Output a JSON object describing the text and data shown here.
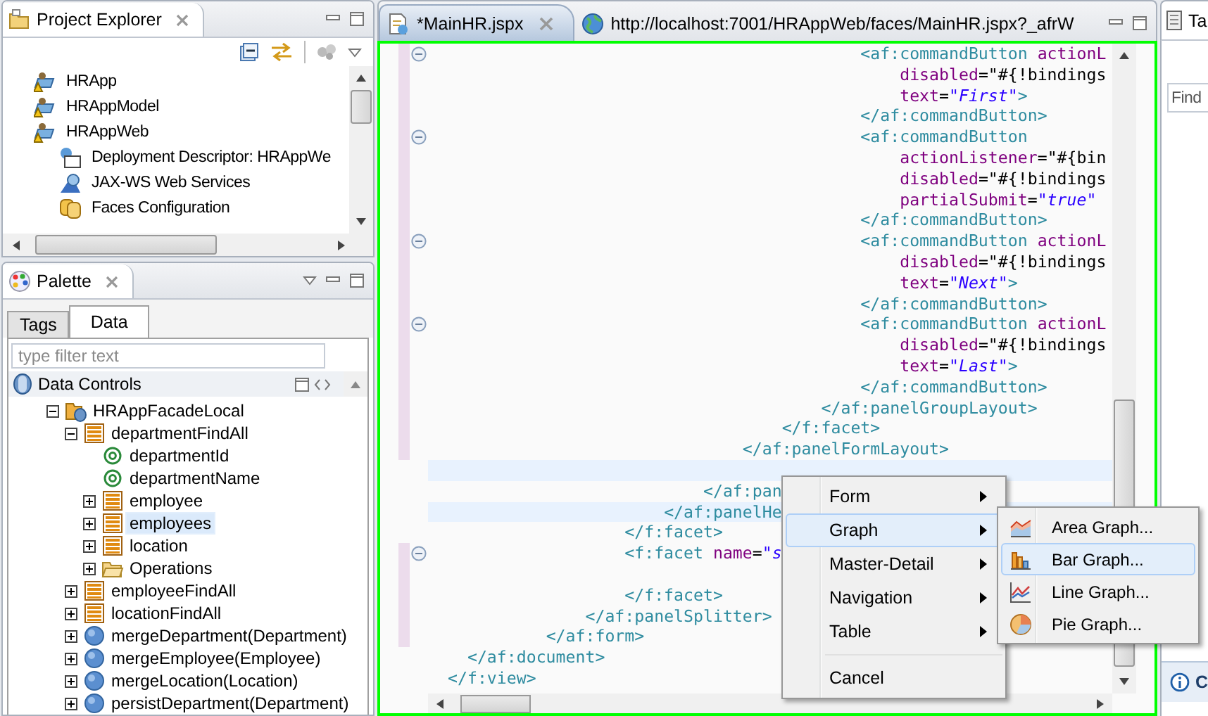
{
  "project_explorer": {
    "title": "Project Explorer",
    "items": [
      {
        "label": "HRApp",
        "kind": "project",
        "selected": false
      },
      {
        "label": "HRAppModel",
        "kind": "project",
        "selected": false
      },
      {
        "label": "HRAppWeb",
        "kind": "project",
        "selected": false,
        "children": [
          {
            "label": "Deployment Descriptor: HRAppWe",
            "kind": "descriptor",
            "selected": false
          },
          {
            "label": "JAX-WS Web Services",
            "kind": "webservices",
            "selected": false
          },
          {
            "label": "Faces Configuration",
            "kind": "faces",
            "selected": false
          }
        ]
      }
    ]
  },
  "palette": {
    "title": "Palette",
    "tabs": [
      {
        "label": "Tags",
        "selected": false
      },
      {
        "label": "Data",
        "selected": true
      }
    ],
    "filter": {
      "placeholder": "type filter text"
    },
    "section": "Data Controls",
    "items": [
      {
        "label": "HRAppFacadeLocal",
        "kind": "datacontrol",
        "expanded": true,
        "selected": false,
        "children": [
          {
            "label": "departmentFindAll",
            "kind": "collection",
            "expanded": true,
            "selected": false,
            "children": [
              {
                "label": "departmentId",
                "kind": "attribute",
                "selected": false
              },
              {
                "label": "departmentName",
                "kind": "attribute",
                "selected": false
              },
              {
                "label": "employee",
                "kind": "collection",
                "expanded": false,
                "selected": false
              },
              {
                "label": "employees",
                "kind": "collection",
                "expanded": false,
                "selected": true
              },
              {
                "label": "location",
                "kind": "collection",
                "expanded": false,
                "selected": false
              },
              {
                "label": "Operations",
                "kind": "folder",
                "expanded": false,
                "selected": false
              }
            ]
          },
          {
            "label": "employeeFindAll",
            "kind": "collection",
            "expanded": false,
            "selected": false
          },
          {
            "label": "locationFindAll",
            "kind": "collection",
            "expanded": false,
            "selected": false
          },
          {
            "label": "mergeDepartment(Department)",
            "kind": "method",
            "expanded": false,
            "selected": false
          },
          {
            "label": "mergeEmployee(Employee)",
            "kind": "method",
            "expanded": false,
            "selected": false
          },
          {
            "label": "mergeLocation(Location)",
            "kind": "method",
            "expanded": false,
            "selected": false
          },
          {
            "label": "persistDepartment(Department)",
            "kind": "method",
            "expanded": false,
            "selected": false
          }
        ]
      }
    ]
  },
  "editor": {
    "tabs": [
      {
        "label": "*MainHR.jspx",
        "kind": "source",
        "selected": true
      },
      {
        "label": "http://localhost:7001/HRAppWeb/faces/MainHR.jspx?_afrW",
        "kind": "browser",
        "selected": false
      }
    ],
    "lines": [
      {
        "text": "                                          <af:commandButton actionL",
        "fold": true,
        "changed": true,
        "highlighted": false
      },
      {
        "text": "                                              disabled=\"#{!bindings",
        "fold": false,
        "changed": true,
        "highlighted": false
      },
      {
        "text": "                                              text=\"First\">",
        "fold": false,
        "changed": true,
        "highlighted": false
      },
      {
        "text": "                                          </af:commandButton>",
        "fold": false,
        "changed": true,
        "highlighted": false
      },
      {
        "text": "                                          <af:commandButton",
        "fold": true,
        "changed": true,
        "highlighted": false
      },
      {
        "text": "                                              actionListener=\"#{bin",
        "fold": false,
        "changed": true,
        "highlighted": false
      },
      {
        "text": "                                              disabled=\"#{!bindings",
        "fold": false,
        "changed": true,
        "highlighted": false
      },
      {
        "text": "                                              partialSubmit=\"true\"",
        "fold": false,
        "changed": true,
        "highlighted": false
      },
      {
        "text": "                                          </af:commandButton>",
        "fold": false,
        "changed": true,
        "highlighted": false
      },
      {
        "text": "                                          <af:commandButton actionL",
        "fold": true,
        "changed": true,
        "highlighted": false
      },
      {
        "text": "                                              disabled=\"#{!bindings",
        "fold": false,
        "changed": true,
        "highlighted": false
      },
      {
        "text": "                                              text=\"Next\">",
        "fold": false,
        "changed": true,
        "highlighted": false
      },
      {
        "text": "                                          </af:commandButton>",
        "fold": false,
        "changed": true,
        "highlighted": false
      },
      {
        "text": "                                          <af:commandButton actionL",
        "fold": true,
        "changed": true,
        "highlighted": false
      },
      {
        "text": "                                              disabled=\"#{!bindings",
        "fold": false,
        "changed": true,
        "highlighted": false
      },
      {
        "text": "                                              text=\"Last\">",
        "fold": false,
        "changed": true,
        "highlighted": false
      },
      {
        "text": "                                          </af:commandButton>",
        "fold": false,
        "changed": true,
        "highlighted": false
      },
      {
        "text": "                                      </af:panelGroupLayout>",
        "fold": false,
        "changed": true,
        "highlighted": false
      },
      {
        "text": "                                  </f:facet>",
        "fold": false,
        "changed": true,
        "highlighted": false
      },
      {
        "text": "                              </af:panelFormLayout>",
        "fold": false,
        "changed": true,
        "highlighted": false
      },
      {
        "fold": false,
        "changed": false,
        "highlighted": true
      },
      {
        "text": "                          </af:pan",
        "fold": false,
        "changed": false,
        "highlighted": false
      },
      {
        "text": "                      </af:panelHe",
        "fold": false,
        "changed": false,
        "highlighted": true
      },
      {
        "text": "                  </f:facet>",
        "fold": false,
        "changed": false,
        "highlighted": false
      },
      {
        "text": "                  <f:facet name=\"s",
        "fold": true,
        "changed": true,
        "highlighted": false
      },
      {
        "fold": false,
        "changed": true,
        "highlighted": false
      },
      {
        "text": "                  </f:facet>",
        "fold": false,
        "changed": true,
        "highlighted": false
      },
      {
        "text": "              </af:panelSplitter>",
        "fold": false,
        "changed": true,
        "highlighted": false
      },
      {
        "text": "          </af:form>",
        "fold": false,
        "changed": true,
        "highlighted": false
      },
      {
        "text": "  </af:document>",
        "fold": false,
        "changed": false,
        "highlighted": false
      },
      {
        "text": "</f:view>",
        "fold": false,
        "changed": false,
        "highlighted": false
      }
    ],
    "context_menu": {
      "items": [
        {
          "label": "Form",
          "kind": "submenu",
          "selected": false
        },
        {
          "label": "Graph",
          "kind": "submenu",
          "selected": true
        },
        {
          "label": "Master-Detail",
          "kind": "submenu",
          "selected": false
        },
        {
          "label": "Navigation",
          "kind": "submenu",
          "selected": false
        },
        {
          "label": "Table",
          "kind": "submenu",
          "selected": false
        },
        {
          "kind": "separator"
        },
        {
          "label": "Cancel",
          "kind": "action",
          "selected": false
        }
      ],
      "submenu": {
        "items": [
          {
            "label": "Area Graph...",
            "kind": "area",
            "selected": false
          },
          {
            "label": "Bar Graph...",
            "kind": "bar",
            "selected": true
          },
          {
            "label": "Line Graph...",
            "kind": "line",
            "selected": false
          },
          {
            "label": "Pie Graph...",
            "kind": "pie",
            "selected": false
          }
        ]
      }
    }
  },
  "right_view": {
    "tab": "Ta",
    "find": {
      "placeholder": "Find"
    },
    "footer": "C"
  }
}
